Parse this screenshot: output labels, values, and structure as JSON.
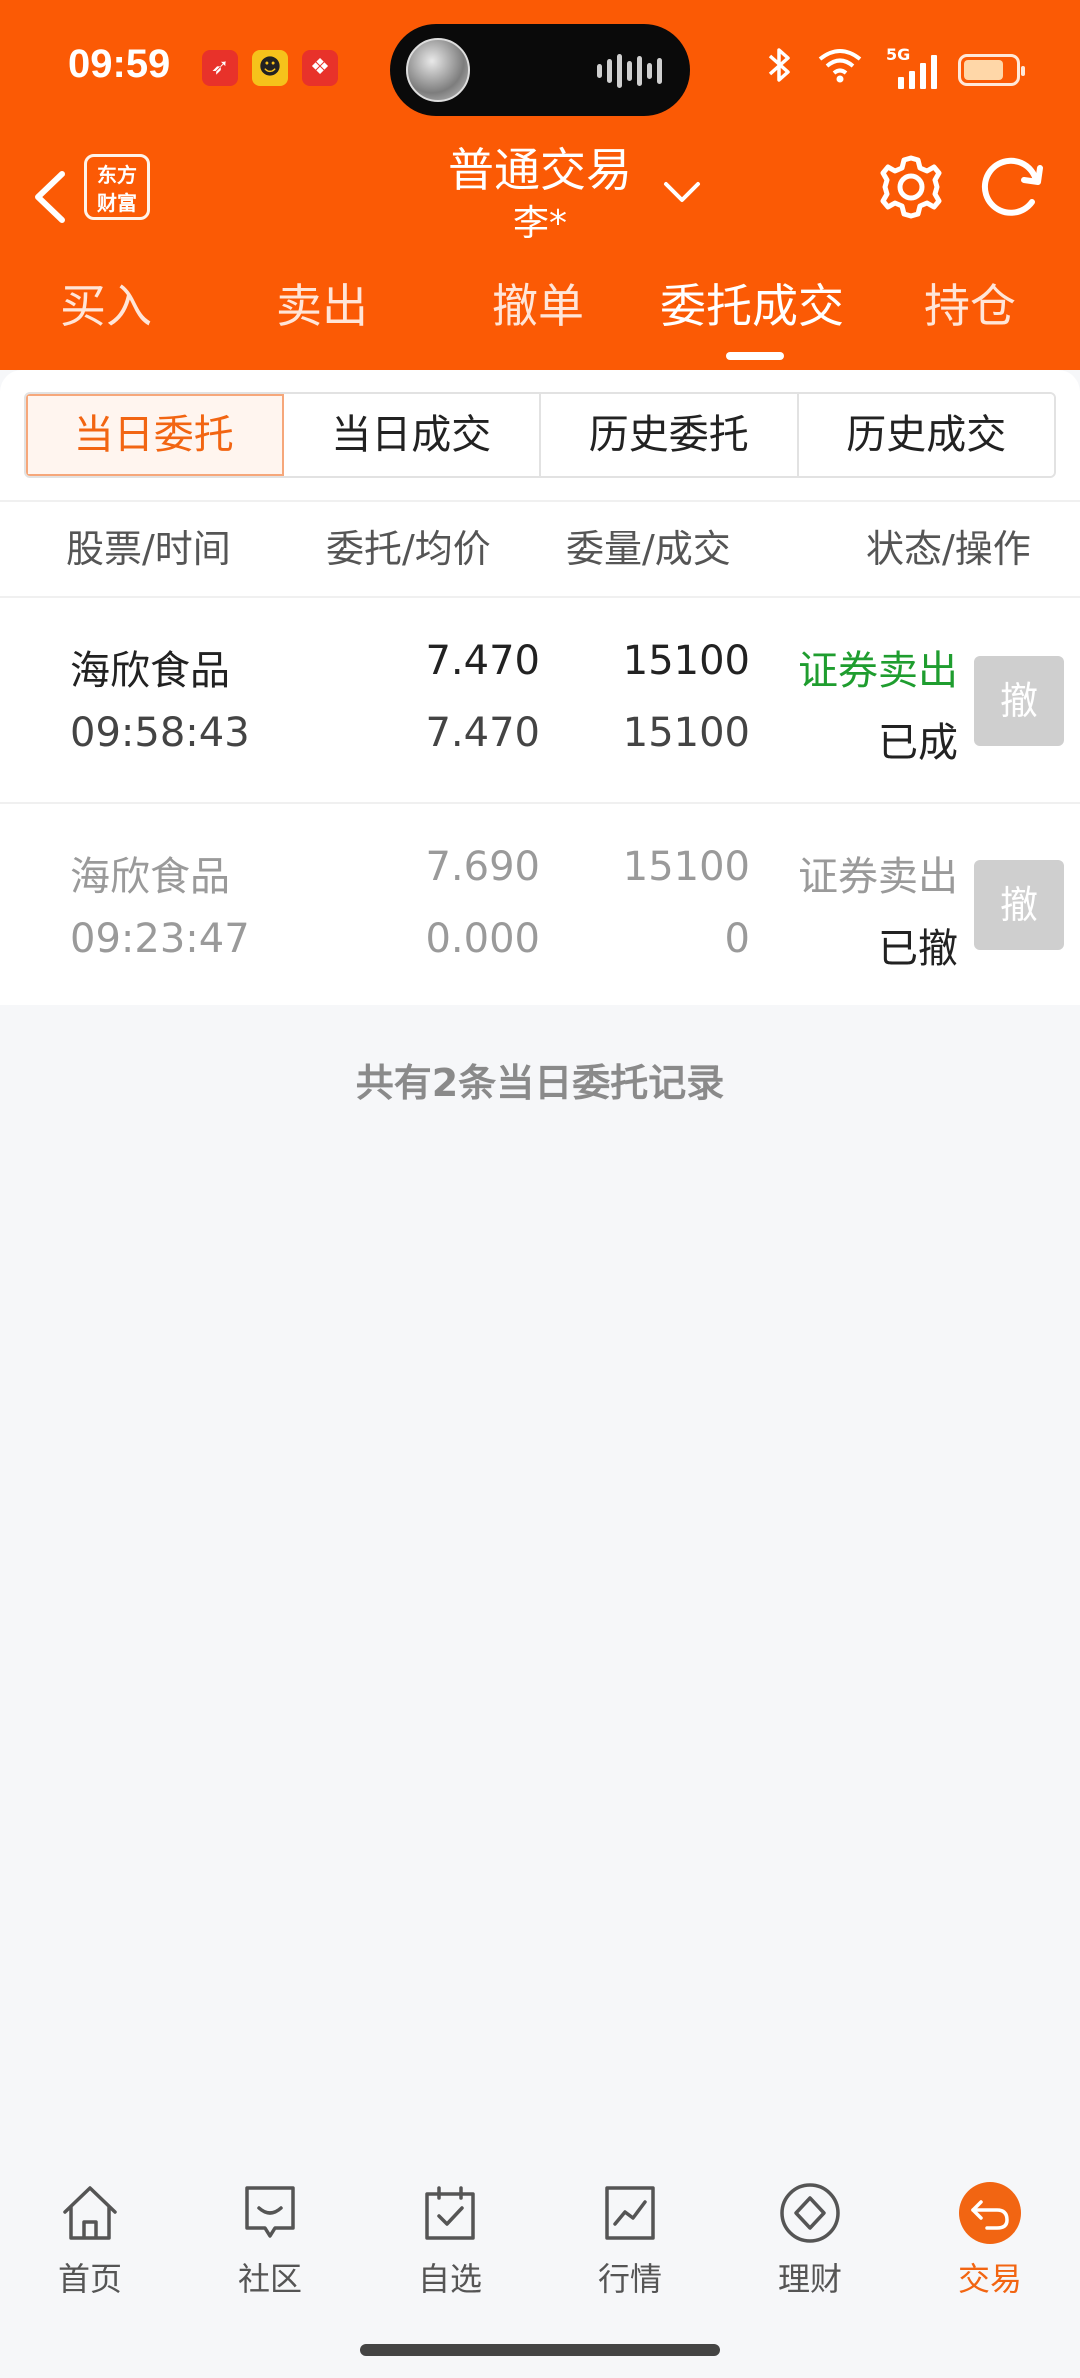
{
  "status_bar": {
    "time": "09:59"
  },
  "header": {
    "logo_line1": "东方",
    "logo_line2": "财富",
    "title": "普通交易",
    "subtitle": "李*"
  },
  "top_tabs": [
    {
      "label": "买入"
    },
    {
      "label": "卖出"
    },
    {
      "label": "撤单"
    },
    {
      "label": "委托成交",
      "active": true
    },
    {
      "label": "持仓"
    }
  ],
  "segments": [
    {
      "label": "当日委托",
      "active": true
    },
    {
      "label": "当日成交"
    },
    {
      "label": "历史委托"
    },
    {
      "label": "历史成交"
    }
  ],
  "columns": {
    "stock_time": "股票/时间",
    "price_avg": "委托/均价",
    "qty_filled": "委量/成交",
    "status_action": "状态/操作"
  },
  "orders": [
    {
      "name": "海欣食品",
      "time": "09:58:43",
      "order_price": "7.470",
      "avg_price": "7.470",
      "order_qty": "15100",
      "filled_qty": "15100",
      "type": "证券卖出",
      "status": "已成",
      "cancel_label": "撤"
    },
    {
      "name": "海欣食品",
      "time": "09:23:47",
      "order_price": "7.690",
      "avg_price": "0.000",
      "order_qty": "15100",
      "filled_qty": "0",
      "type": "证券卖出",
      "status": "已撤",
      "cancel_label": "撤"
    }
  ],
  "summary": "共有2条当日委托记录",
  "bottom_nav": [
    {
      "label": "首页",
      "icon": "home-icon"
    },
    {
      "label": "社区",
      "icon": "chat-icon"
    },
    {
      "label": "自选",
      "icon": "watchlist-icon"
    },
    {
      "label": "行情",
      "icon": "chart-icon"
    },
    {
      "label": "理财",
      "icon": "diamond-icon"
    },
    {
      "label": "交易",
      "icon": "trade-icon",
      "active": true
    }
  ],
  "colors": {
    "brand_orange": "#fb5a05",
    "sell_green": "#1f9d2f",
    "active_orange": "#f26512"
  }
}
